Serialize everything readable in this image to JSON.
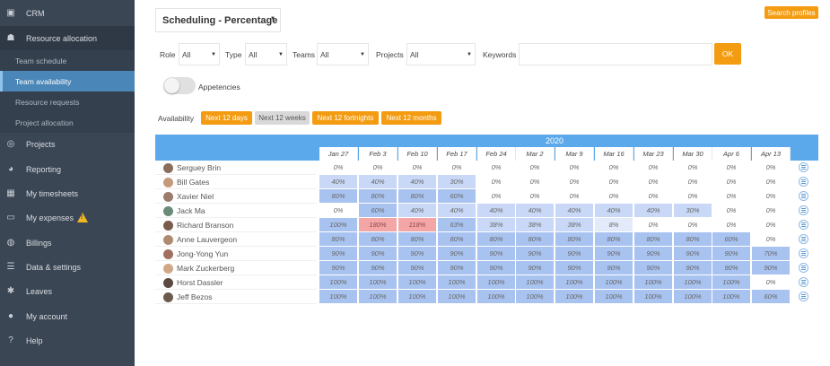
{
  "sidebar": {
    "items": [
      {
        "label": "CRM",
        "icon": "id-card-icon"
      },
      {
        "label": "Resource allocation",
        "icon": "people-icon"
      },
      {
        "label": "Projects",
        "icon": "target-icon"
      },
      {
        "label": "Reporting",
        "icon": "pie-chart-icon"
      },
      {
        "label": "My timesheets",
        "icon": "calendar-icon"
      },
      {
        "label": "My expenses",
        "icon": "wallet-icon"
      },
      {
        "label": "Billings",
        "icon": "billing-icon"
      },
      {
        "label": "Data & settings",
        "icon": "database-icon"
      },
      {
        "label": "Leaves",
        "icon": "palm-tree-icon"
      },
      {
        "label": "My account",
        "icon": "user-icon"
      },
      {
        "label": "Help",
        "icon": "question-icon"
      }
    ],
    "subitems": [
      "Team schedule",
      "Team availability",
      "Resource requests",
      "Project allocation"
    ]
  },
  "header": {
    "view_select": "Scheduling - Percentage",
    "search_profiles": "Search profiles"
  },
  "filters": {
    "role_label": "Role",
    "role_value": "All",
    "type_label": "Type",
    "type_value": "All",
    "teams_label": "Teams",
    "teams_value": "All",
    "projects_label": "Projects",
    "projects_value": "All",
    "keywords_label": "Keywords",
    "keywords_value": "",
    "ok_label": "OK"
  },
  "toggle_label": "Appetencies",
  "availability": {
    "label": "Availability",
    "ranges": [
      {
        "label": "Next 12 days",
        "active": true
      },
      {
        "label": "Next 12 weeks",
        "active": false
      },
      {
        "label": "Next 12 fortnights",
        "active": true
      },
      {
        "label": "Next 12 months",
        "active": true
      }
    ]
  },
  "grid": {
    "year": "2020",
    "weeks": [
      "Jan 27",
      "Feb 3",
      "Feb 10",
      "Feb 17",
      "Feb 24",
      "Mar 2",
      "Mar 9",
      "Mar 16",
      "Mar 23",
      "Mar 30",
      "Apr 6",
      "Apr 13"
    ],
    "people": [
      {
        "name": "Serguey Brin",
        "values": [
          0,
          0,
          0,
          0,
          0,
          0,
          0,
          0,
          0,
          0,
          0,
          0
        ]
      },
      {
        "name": "Bill Gates",
        "values": [
          40,
          40,
          40,
          30,
          0,
          0,
          0,
          0,
          0,
          0,
          0,
          0
        ]
      },
      {
        "name": "Xavier Niel",
        "values": [
          80,
          80,
          80,
          60,
          0,
          0,
          0,
          0,
          0,
          0,
          0,
          0
        ]
      },
      {
        "name": "Jack Ma",
        "values": [
          0,
          60,
          40,
          40,
          40,
          40,
          40,
          40,
          40,
          30,
          0,
          0
        ]
      },
      {
        "name": "Richard Branson",
        "values": [
          100,
          180,
          118,
          63,
          38,
          38,
          38,
          8,
          0,
          0,
          0,
          0
        ]
      },
      {
        "name": "Anne Lauvergeon",
        "values": [
          80,
          80,
          80,
          80,
          80,
          80,
          80,
          80,
          80,
          80,
          60,
          0
        ]
      },
      {
        "name": "Jong-Yong Yun",
        "values": [
          90,
          90,
          90,
          90,
          90,
          90,
          90,
          90,
          90,
          90,
          90,
          70
        ]
      },
      {
        "name": "Mark Zuckerberg",
        "values": [
          90,
          90,
          90,
          90,
          90,
          90,
          90,
          90,
          90,
          90,
          90,
          90
        ]
      },
      {
        "name": "Horst Dassler",
        "values": [
          100,
          100,
          100,
          100,
          100,
          100,
          100,
          100,
          100,
          100,
          100,
          0
        ]
      },
      {
        "name": "Jeff Bezos",
        "values": [
          100,
          100,
          100,
          100,
          100,
          100,
          100,
          100,
          100,
          100,
          100,
          60
        ]
      }
    ],
    "colors": {
      "over": "#f4a6a6",
      "high": "#a9c3f0",
      "mid": "#c8d8f6",
      "low": "#e3ebfb",
      "zero": "#ffffff"
    }
  }
}
